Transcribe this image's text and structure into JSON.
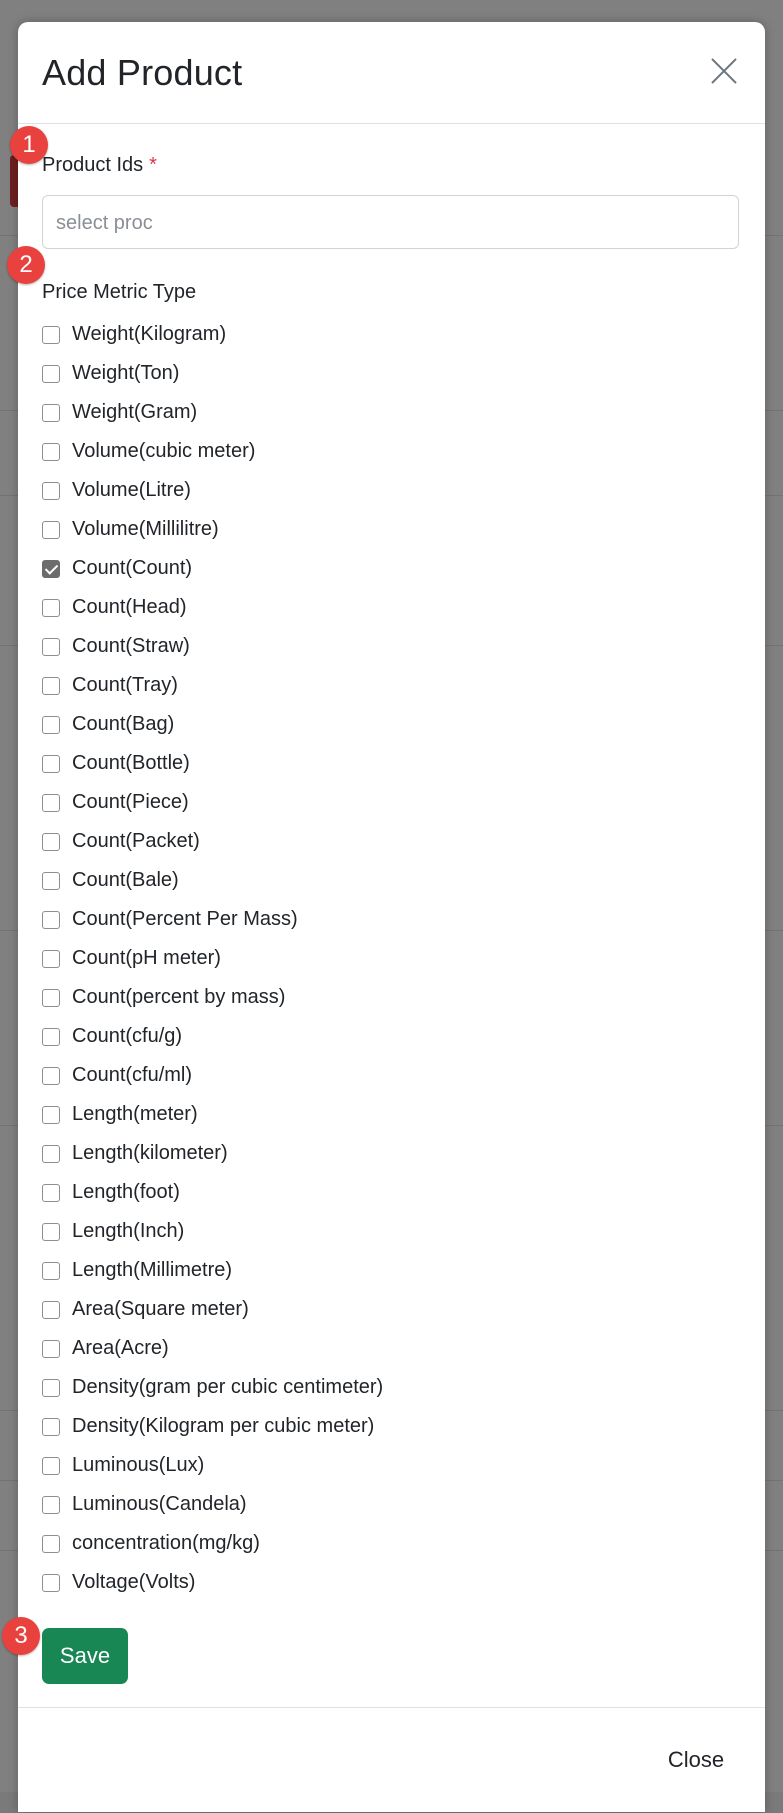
{
  "modal": {
    "title": "Add Product",
    "close_icon": "close-icon",
    "product_ids": {
      "label": "Product Ids",
      "required_mark": "*",
      "placeholder": "select proc"
    },
    "price_metric_type": {
      "label": "Price Metric Type",
      "options": [
        {
          "label": "Weight(Kilogram)",
          "checked": false
        },
        {
          "label": "Weight(Ton)",
          "checked": false
        },
        {
          "label": "Weight(Gram)",
          "checked": false
        },
        {
          "label": "Volume(cubic meter)",
          "checked": false
        },
        {
          "label": "Volume(Litre)",
          "checked": false
        },
        {
          "label": "Volume(Millilitre)",
          "checked": false
        },
        {
          "label": "Count(Count)",
          "checked": true
        },
        {
          "label": "Count(Head)",
          "checked": false
        },
        {
          "label": "Count(Straw)",
          "checked": false
        },
        {
          "label": "Count(Tray)",
          "checked": false
        },
        {
          "label": "Count(Bag)",
          "checked": false
        },
        {
          "label": "Count(Bottle)",
          "checked": false
        },
        {
          "label": "Count(Piece)",
          "checked": false
        },
        {
          "label": "Count(Packet)",
          "checked": false
        },
        {
          "label": "Count(Bale)",
          "checked": false
        },
        {
          "label": "Count(Percent Per Mass)",
          "checked": false
        },
        {
          "label": "Count(pH meter)",
          "checked": false
        },
        {
          "label": "Count(percent by mass)",
          "checked": false
        },
        {
          "label": "Count(cfu/g)",
          "checked": false
        },
        {
          "label": "Count(cfu/ml)",
          "checked": false
        },
        {
          "label": "Length(meter)",
          "checked": false
        },
        {
          "label": "Length(kilometer)",
          "checked": false
        },
        {
          "label": "Length(foot)",
          "checked": false
        },
        {
          "label": "Length(Inch)",
          "checked": false
        },
        {
          "label": "Length(Millimetre)",
          "checked": false
        },
        {
          "label": "Area(Square meter)",
          "checked": false
        },
        {
          "label": "Area(Acre)",
          "checked": false
        },
        {
          "label": "Density(gram per cubic centimeter)",
          "checked": false
        },
        {
          "label": "Density(Kilogram per cubic meter)",
          "checked": false
        },
        {
          "label": "Luminous(Lux)",
          "checked": false
        },
        {
          "label": "Luminous(Candela)",
          "checked": false
        },
        {
          "label": "concentration(mg/kg)",
          "checked": false
        },
        {
          "label": "Voltage(Volts)",
          "checked": false
        }
      ]
    },
    "save_label": "Save",
    "close_label": "Close"
  },
  "markers": [
    "1",
    "2",
    "3"
  ],
  "colors": {
    "save_button": "#198754",
    "required": "#dc3545",
    "marker": "#e8413e",
    "checked": "#6c6c6c"
  }
}
